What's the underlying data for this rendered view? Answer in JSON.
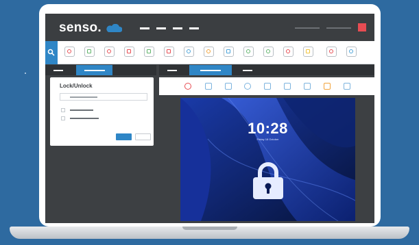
{
  "app": {
    "brand": "senso.",
    "colors": {
      "accent": "#2f86c6",
      "header": "#3b3e41",
      "stop": "#e74c52",
      "background": "#2e6aa0"
    }
  },
  "toolbar": {
    "icons": [
      "block-icon",
      "web-filter-icon",
      "mute-icon",
      "safety-icon",
      "chat-icon",
      "video-icon",
      "login-icon",
      "rocket-icon",
      "document-icon",
      "group-icon",
      "launch-icon",
      "usb-icon",
      "clipboard-icon",
      "warning-icon",
      "shield-icon"
    ]
  },
  "dialog": {
    "title": "Lock/Unlock"
  },
  "remote": {
    "time": "10:28",
    "date": "Friday 18 October"
  }
}
